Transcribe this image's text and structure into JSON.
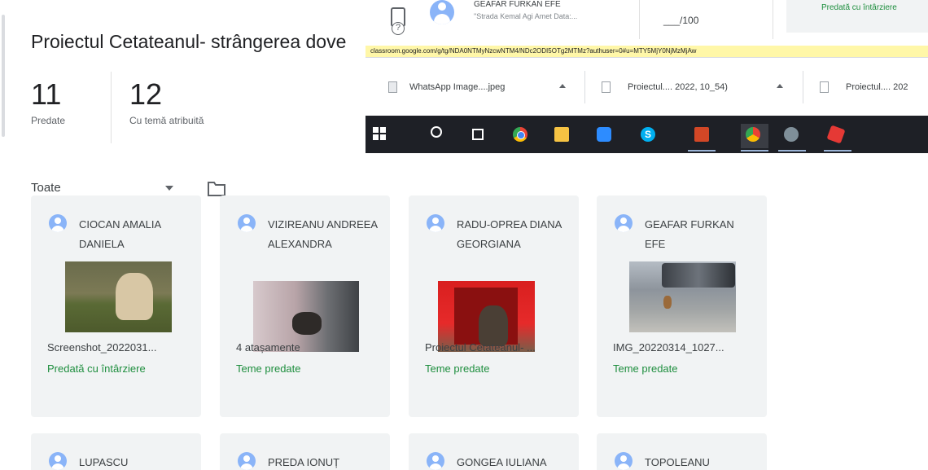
{
  "assignment": {
    "title": "Proiectul Cetateanul- strângerea dove"
  },
  "stats": {
    "submitted": {
      "value": "11",
      "label": "Predate"
    },
    "assigned": {
      "value": "12",
      "label": "Cu temă atribuită"
    }
  },
  "filter": {
    "selected": "Toate"
  },
  "students": [
    {
      "name": "CIOCAN AMALIA DANIELA",
      "attachment": "Screenshot_2022031...",
      "status": "Predată cu întârziere"
    },
    {
      "name": "VIZIREANU ANDREEA ALEXANDRA",
      "attachment": "4 atașamente",
      "status": "Teme predate"
    },
    {
      "name": "RADU-OPREA DIANA GEORGIANA",
      "attachment": "Proiectul Cetateanul- ...",
      "status": "Teme predate"
    },
    {
      "name": "GEAFAR FURKAN EFE",
      "attachment": "IMG_20220314_1027...",
      "status": "Teme predate"
    },
    {
      "name": "LUPASCU"
    },
    {
      "name": "PREDA IONUȚ"
    },
    {
      "name": "GONGEA IULIANA"
    },
    {
      "name": "TOPOLEANU"
    }
  ],
  "overlay": {
    "student_name": "GEAFAR FURKAN EFE",
    "student_subtext": "\"Strada Kemal Agi Amet Data:...",
    "grade": "___/100",
    "right_status": "Predată cu întârziere",
    "url": "classroom.google.com/g/tg/NDA0NTMyNzcwNTM4/NDc2ODI5OTg2MTMz?authuser=0#u=MTY5MjY0NjMzMjAw",
    "downloads": [
      {
        "name": "WhatsApp Image....jpeg",
        "icon": "image-file-icon"
      },
      {
        "name": "Proiectul.... 2022, 10_54)",
        "icon": "document-file-icon"
      },
      {
        "name": "Proiectul.... 202",
        "icon": "document-file-icon"
      }
    ],
    "taskbar_icons": [
      "windows-start-icon",
      "search-icon",
      "task-view-icon",
      "chrome-icon",
      "file-explorer-icon",
      "zoom-icon",
      "skype-icon",
      "powerpoint-icon",
      "chrome-profile-icon",
      "bird-app-icon",
      "red-app-icon"
    ]
  },
  "colors": {
    "accent_green": "#1e8e3e",
    "card_bg": "#f1f3f4",
    "avatar_blue": "#8ab4f8",
    "url_highlight": "#fff7a8",
    "taskbar_bg": "#1e2026"
  }
}
